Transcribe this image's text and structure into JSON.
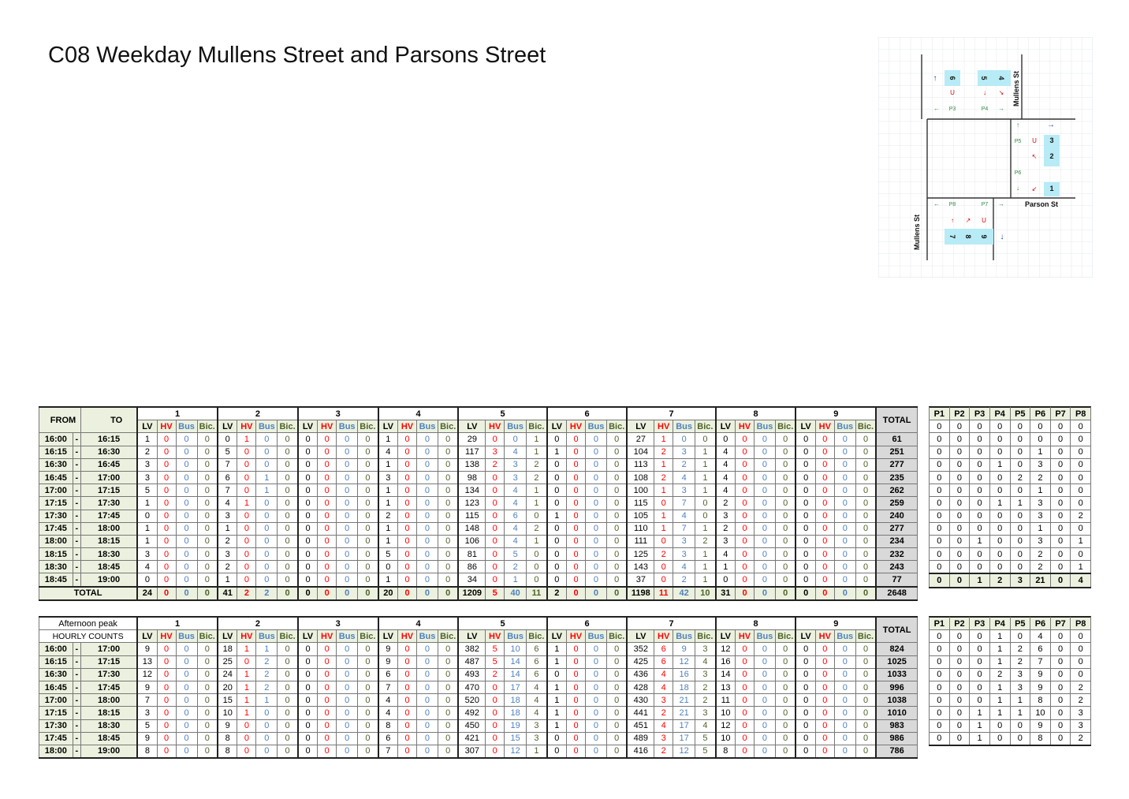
{
  "title": "C08 Weekday Mullens Street and Parsons Street",
  "diagram": {
    "street_north": "Mullens St",
    "street_south": "Mullens St",
    "street_east": "Parson St",
    "movements": [
      "1",
      "2",
      "3",
      "4",
      "5",
      "6",
      "7",
      "8",
      "9"
    ],
    "peds": [
      "P3",
      "P4",
      "P5",
      "P6",
      "P7",
      "P8"
    ],
    "u_turn": "U"
  },
  "table1": {
    "from_label": "FROM",
    "to_label": "TO",
    "dash": "-",
    "total_label": "TOTAL",
    "groups": [
      "1",
      "2",
      "3",
      "4",
      "5",
      "6",
      "7",
      "8",
      "9"
    ],
    "sub": [
      "LV",
      "HV",
      "Bus",
      "Bic."
    ],
    "ped_headers": [
      "P1",
      "P2",
      "P3",
      "P4",
      "P5",
      "P6",
      "P7",
      "P8"
    ],
    "rows": [
      {
        "from": "16:00",
        "to": "16:15",
        "v": [
          1,
          0,
          0,
          0,
          0,
          1,
          0,
          0,
          0,
          0,
          0,
          0,
          1,
          0,
          0,
          0,
          29,
          0,
          0,
          1,
          0,
          0,
          0,
          0,
          27,
          1,
          0,
          0,
          0,
          0,
          0,
          0,
          0,
          0,
          0,
          0
        ],
        "total": 61,
        "p": [
          0,
          0,
          0,
          0,
          0,
          0,
          0,
          0
        ]
      },
      {
        "from": "16:15",
        "to": "16:30",
        "v": [
          2,
          0,
          0,
          0,
          5,
          0,
          0,
          0,
          0,
          0,
          0,
          0,
          4,
          0,
          0,
          0,
          117,
          3,
          4,
          1,
          1,
          0,
          0,
          0,
          104,
          2,
          3,
          1,
          4,
          0,
          0,
          0,
          0,
          0,
          0,
          0
        ],
        "total": 251,
        "p": [
          0,
          0,
          0,
          0,
          0,
          0,
          0,
          0
        ]
      },
      {
        "from": "16:30",
        "to": "16:45",
        "v": [
          3,
          0,
          0,
          0,
          7,
          0,
          0,
          0,
          0,
          0,
          0,
          0,
          1,
          0,
          0,
          0,
          138,
          2,
          3,
          2,
          0,
          0,
          0,
          0,
          113,
          1,
          2,
          1,
          4,
          0,
          0,
          0,
          0,
          0,
          0,
          0
        ],
        "total": 277,
        "p": [
          0,
          0,
          0,
          0,
          0,
          1,
          0,
          0
        ]
      },
      {
        "from": "16:45",
        "to": "17:00",
        "v": [
          3,
          0,
          0,
          0,
          6,
          0,
          1,
          0,
          0,
          0,
          0,
          0,
          3,
          0,
          0,
          0,
          98,
          0,
          3,
          2,
          0,
          0,
          0,
          0,
          108,
          2,
          4,
          1,
          4,
          0,
          0,
          0,
          0,
          0,
          0,
          0
        ],
        "total": 235,
        "p": [
          0,
          0,
          0,
          1,
          0,
          3,
          0,
          0
        ]
      },
      {
        "from": "17:00",
        "to": "17:15",
        "v": [
          5,
          0,
          0,
          0,
          7,
          0,
          1,
          0,
          0,
          0,
          0,
          0,
          1,
          0,
          0,
          0,
          134,
          0,
          4,
          1,
          0,
          0,
          0,
          0,
          100,
          1,
          3,
          1,
          4,
          0,
          0,
          0,
          0,
          0,
          0,
          0
        ],
        "total": 262,
        "p": [
          0,
          0,
          0,
          0,
          2,
          2,
          0,
          0
        ]
      },
      {
        "from": "17:15",
        "to": "17:30",
        "v": [
          1,
          0,
          0,
          0,
          4,
          1,
          0,
          0,
          0,
          0,
          0,
          0,
          1,
          0,
          0,
          0,
          123,
          0,
          4,
          1,
          0,
          0,
          0,
          0,
          115,
          0,
          7,
          0,
          2,
          0,
          0,
          0,
          0,
          0,
          0,
          0
        ],
        "total": 259,
        "p": [
          0,
          0,
          0,
          0,
          0,
          1,
          0,
          0
        ]
      },
      {
        "from": "17:30",
        "to": "17:45",
        "v": [
          0,
          0,
          0,
          0,
          3,
          0,
          0,
          0,
          0,
          0,
          0,
          0,
          2,
          0,
          0,
          0,
          115,
          0,
          6,
          0,
          1,
          0,
          0,
          0,
          105,
          1,
          4,
          0,
          3,
          0,
          0,
          0,
          0,
          0,
          0,
          0
        ],
        "total": 240,
        "p": [
          0,
          0,
          0,
          1,
          1,
          3,
          0,
          0
        ]
      },
      {
        "from": "17:45",
        "to": "18:00",
        "v": [
          1,
          0,
          0,
          0,
          1,
          0,
          0,
          0,
          0,
          0,
          0,
          0,
          1,
          0,
          0,
          0,
          148,
          0,
          4,
          2,
          0,
          0,
          0,
          0,
          110,
          1,
          7,
          1,
          2,
          0,
          0,
          0,
          0,
          0,
          0,
          0
        ],
        "total": 277,
        "p": [
          0,
          0,
          0,
          0,
          0,
          3,
          0,
          2
        ]
      },
      {
        "from": "18:00",
        "to": "18:15",
        "v": [
          1,
          0,
          0,
          0,
          2,
          0,
          0,
          0,
          0,
          0,
          0,
          0,
          1,
          0,
          0,
          0,
          106,
          0,
          4,
          1,
          0,
          0,
          0,
          0,
          111,
          0,
          3,
          2,
          3,
          0,
          0,
          0,
          0,
          0,
          0,
          0
        ],
        "total": 234,
        "p": [
          0,
          0,
          0,
          0,
          0,
          1,
          0,
          0
        ]
      },
      {
        "from": "18:15",
        "to": "18:30",
        "v": [
          3,
          0,
          0,
          0,
          3,
          0,
          0,
          0,
          0,
          0,
          0,
          0,
          5,
          0,
          0,
          0,
          81,
          0,
          5,
          0,
          0,
          0,
          0,
          0,
          125,
          2,
          3,
          1,
          4,
          0,
          0,
          0,
          0,
          0,
          0,
          0
        ],
        "total": 232,
        "p": [
          0,
          0,
          1,
          0,
          0,
          3,
          0,
          1
        ]
      },
      {
        "from": "18:30",
        "to": "18:45",
        "v": [
          4,
          0,
          0,
          0,
          2,
          0,
          0,
          0,
          0,
          0,
          0,
          0,
          0,
          0,
          0,
          0,
          86,
          0,
          2,
          0,
          0,
          0,
          0,
          0,
          143,
          0,
          4,
          1,
          1,
          0,
          0,
          0,
          0,
          0,
          0,
          0
        ],
        "total": 243,
        "p": [
          0,
          0,
          0,
          0,
          0,
          2,
          0,
          0
        ]
      },
      {
        "from": "18:45",
        "to": "19:00",
        "v": [
          0,
          0,
          0,
          0,
          1,
          0,
          0,
          0,
          0,
          0,
          0,
          0,
          1,
          0,
          0,
          0,
          34,
          0,
          1,
          0,
          0,
          0,
          0,
          0,
          37,
          0,
          2,
          1,
          0,
          0,
          0,
          0,
          0,
          0,
          0,
          0
        ],
        "total": 77,
        "p": [
          0,
          0,
          0,
          0,
          0,
          2,
          0,
          1
        ]
      }
    ],
    "totals": {
      "label": "TOTAL",
      "v": [
        24,
        0,
        0,
        0,
        41,
        2,
        2,
        0,
        0,
        0,
        0,
        0,
        20,
        0,
        0,
        0,
        1209,
        5,
        40,
        11,
        2,
        0,
        0,
        0,
        1198,
        11,
        42,
        10,
        31,
        0,
        0,
        0,
        0,
        0,
        0,
        0
      ],
      "total": 2648,
      "p": [
        0,
        0,
        1,
        2,
        3,
        21,
        0,
        4
      ]
    }
  },
  "table2": {
    "peak_label": "Afternoon peak",
    "hourly_label": "HOURLY COUNTS",
    "dash": "-",
    "total_label": "TOTAL",
    "groups": [
      "1",
      "2",
      "3",
      "4",
      "5",
      "6",
      "7",
      "8",
      "9"
    ],
    "sub": [
      "LV",
      "HV",
      "Bus",
      "Bic."
    ],
    "ped_headers": [
      "P1",
      "P2",
      "P3",
      "P4",
      "P5",
      "P6",
      "P7",
      "P8"
    ],
    "rows": [
      {
        "from": "16:00",
        "to": "17:00",
        "v": [
          9,
          0,
          0,
          0,
          18,
          1,
          1,
          0,
          0,
          0,
          0,
          0,
          9,
          0,
          0,
          0,
          382,
          5,
          10,
          6,
          1,
          0,
          0,
          0,
          352,
          6,
          9,
          3,
          12,
          0,
          0,
          0,
          0,
          0,
          0,
          0
        ],
        "total": 824,
        "p": [
          0,
          0,
          0,
          1,
          0,
          4,
          0,
          0
        ]
      },
      {
        "from": "16:15",
        "to": "17:15",
        "v": [
          13,
          0,
          0,
          0,
          25,
          0,
          2,
          0,
          0,
          0,
          0,
          0,
          9,
          0,
          0,
          0,
          487,
          5,
          14,
          6,
          1,
          0,
          0,
          0,
          425,
          6,
          12,
          4,
          16,
          0,
          0,
          0,
          0,
          0,
          0,
          0
        ],
        "total": 1025,
        "p": [
          0,
          0,
          0,
          1,
          2,
          6,
          0,
          0
        ]
      },
      {
        "from": "16:30",
        "to": "17:30",
        "v": [
          12,
          0,
          0,
          0,
          24,
          1,
          2,
          0,
          0,
          0,
          0,
          0,
          6,
          0,
          0,
          0,
          493,
          2,
          14,
          6,
          0,
          0,
          0,
          0,
          436,
          4,
          16,
          3,
          14,
          0,
          0,
          0,
          0,
          0,
          0,
          0
        ],
        "total": 1033,
        "p": [
          0,
          0,
          0,
          1,
          2,
          7,
          0,
          0
        ]
      },
      {
        "from": "16:45",
        "to": "17:45",
        "v": [
          9,
          0,
          0,
          0,
          20,
          1,
          2,
          0,
          0,
          0,
          0,
          0,
          7,
          0,
          0,
          0,
          470,
          0,
          17,
          4,
          1,
          0,
          0,
          0,
          428,
          4,
          18,
          2,
          13,
          0,
          0,
          0,
          0,
          0,
          0,
          0
        ],
        "total": 996,
        "p": [
          0,
          0,
          0,
          2,
          3,
          9,
          0,
          0
        ]
      },
      {
        "from": "17:00",
        "to": "18:00",
        "v": [
          7,
          0,
          0,
          0,
          15,
          1,
          1,
          0,
          0,
          0,
          0,
          0,
          4,
          0,
          0,
          0,
          520,
          0,
          18,
          4,
          1,
          0,
          0,
          0,
          430,
          3,
          21,
          2,
          11,
          0,
          0,
          0,
          0,
          0,
          0,
          0
        ],
        "total": 1038,
        "p": [
          0,
          0,
          0,
          1,
          3,
          9,
          0,
          2
        ]
      },
      {
        "from": "17:15",
        "to": "18:15",
        "v": [
          3,
          0,
          0,
          0,
          10,
          1,
          0,
          0,
          0,
          0,
          0,
          0,
          4,
          0,
          0,
          0,
          492,
          0,
          18,
          4,
          1,
          0,
          0,
          0,
          441,
          2,
          21,
          3,
          10,
          0,
          0,
          0,
          0,
          0,
          0,
          0
        ],
        "total": 1010,
        "p": [
          0,
          0,
          0,
          1,
          1,
          8,
          0,
          2
        ]
      },
      {
        "from": "17:30",
        "to": "18:30",
        "v": [
          5,
          0,
          0,
          0,
          9,
          0,
          0,
          0,
          0,
          0,
          0,
          0,
          8,
          0,
          0,
          0,
          450,
          0,
          19,
          3,
          1,
          0,
          0,
          0,
          451,
          4,
          17,
          4,
          12,
          0,
          0,
          0,
          0,
          0,
          0,
          0
        ],
        "total": 983,
        "p": [
          0,
          0,
          1,
          1,
          1,
          10,
          0,
          3
        ]
      },
      {
        "from": "17:45",
        "to": "18:45",
        "v": [
          9,
          0,
          0,
          0,
          8,
          0,
          0,
          0,
          0,
          0,
          0,
          0,
          6,
          0,
          0,
          0,
          421,
          0,
          15,
          3,
          0,
          0,
          0,
          0,
          489,
          3,
          17,
          5,
          10,
          0,
          0,
          0,
          0,
          0,
          0,
          0
        ],
        "total": 986,
        "p": [
          0,
          0,
          1,
          0,
          0,
          9,
          0,
          3
        ]
      },
      {
        "from": "18:00",
        "to": "19:00",
        "v": [
          8,
          0,
          0,
          0,
          8,
          0,
          0,
          0,
          0,
          0,
          0,
          0,
          7,
          0,
          0,
          0,
          307,
          0,
          12,
          1,
          0,
          0,
          0,
          0,
          416,
          2,
          12,
          5,
          8,
          0,
          0,
          0,
          0,
          0,
          0,
          0
        ],
        "total": 786,
        "p": [
          0,
          0,
          1,
          0,
          0,
          8,
          0,
          2
        ]
      }
    ]
  }
}
